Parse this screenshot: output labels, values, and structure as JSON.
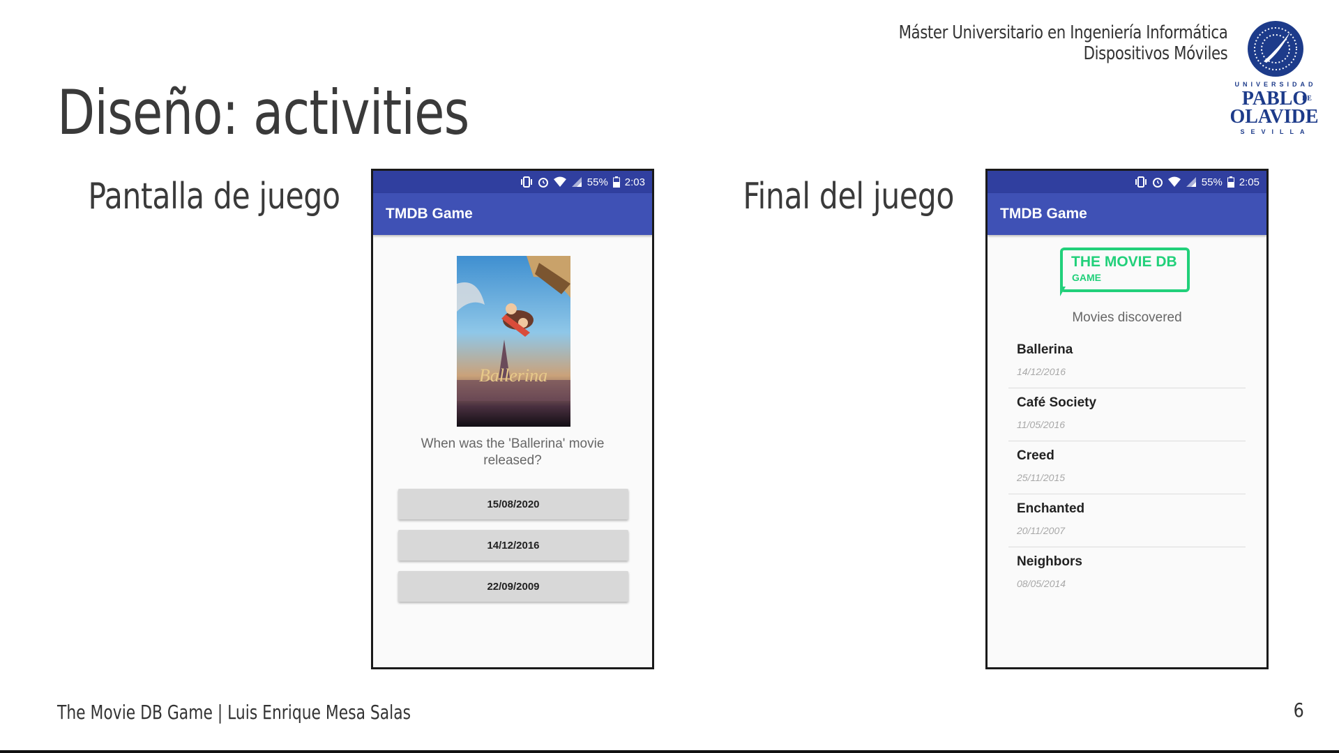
{
  "slide": {
    "header_line1": "Máster Universitario en Ingeniería Informática",
    "header_line2": "Dispositivos Móviles",
    "title": "Diseño: activities",
    "footer": "The Movie DB Game | Luis Enrique Mesa Salas",
    "page_number": "6"
  },
  "university_logo": {
    "top_word": "UNIVERSIDAD",
    "name_line1": "PABLO",
    "name_de": "DE",
    "name_line2": "OLAVIDE",
    "city": "SEVILLA",
    "color": "#1d3b8a"
  },
  "sections": {
    "left_label": "Pantalla de juego",
    "right_label": "Final del juego"
  },
  "colors": {
    "status_bar": "#303f9f",
    "app_bar": "#3f51b5",
    "game_logo_green": "#21d07a"
  },
  "game_screen": {
    "status": {
      "battery": "55%",
      "time": "2:03",
      "icons": [
        "vibrate-icon",
        "alarm-icon",
        "wifi-icon",
        "signal-icon",
        "battery-icon"
      ]
    },
    "app_title": "TMDB Game",
    "poster_title": "Ballerina",
    "question": "When was the 'Ballerina' movie released?",
    "answers": [
      "15/08/2020",
      "14/12/2016",
      "22/09/2009"
    ]
  },
  "final_screen": {
    "status": {
      "battery": "55%",
      "time": "2:05",
      "icons": [
        "vibrate-icon",
        "alarm-icon",
        "wifi-icon",
        "signal-icon",
        "battery-icon"
      ]
    },
    "app_title": "TMDB Game",
    "logo_main": "THE MOVIE DB",
    "logo_sub": "GAME",
    "list_title": "Movies discovered",
    "movies": [
      {
        "title": "Ballerina",
        "date": "14/12/2016"
      },
      {
        "title": "Café Society",
        "date": "11/05/2016"
      },
      {
        "title": "Creed",
        "date": "25/11/2015"
      },
      {
        "title": "Enchanted",
        "date": "20/11/2007"
      },
      {
        "title": "Neighbors",
        "date": "08/05/2014"
      }
    ]
  }
}
